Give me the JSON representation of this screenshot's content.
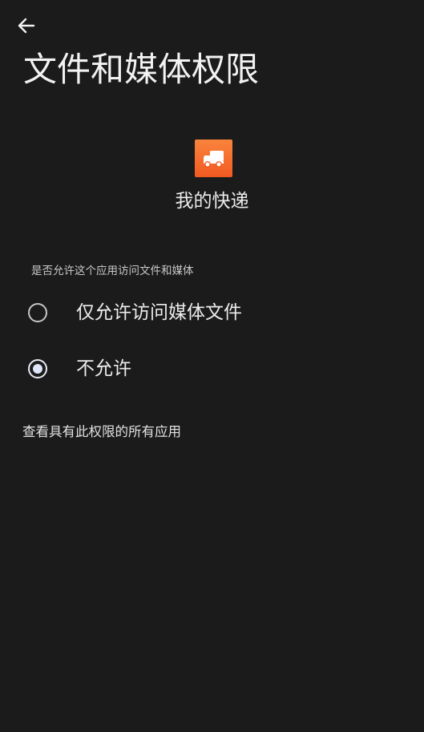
{
  "header": {
    "back_icon": "arrow-left-icon",
    "title": "文件和媒体权限"
  },
  "app": {
    "icon": "delivery-truck-icon",
    "icon_color": "#f4692a",
    "name": "我的快递"
  },
  "permission": {
    "question": "是否允许这个应用访问文件和媒体",
    "options": [
      {
        "label": "仅允许访问媒体文件",
        "selected": false
      },
      {
        "label": "不允许",
        "selected": true
      }
    ]
  },
  "footer": {
    "see_all_link": "查看具有此权限的所有应用"
  }
}
